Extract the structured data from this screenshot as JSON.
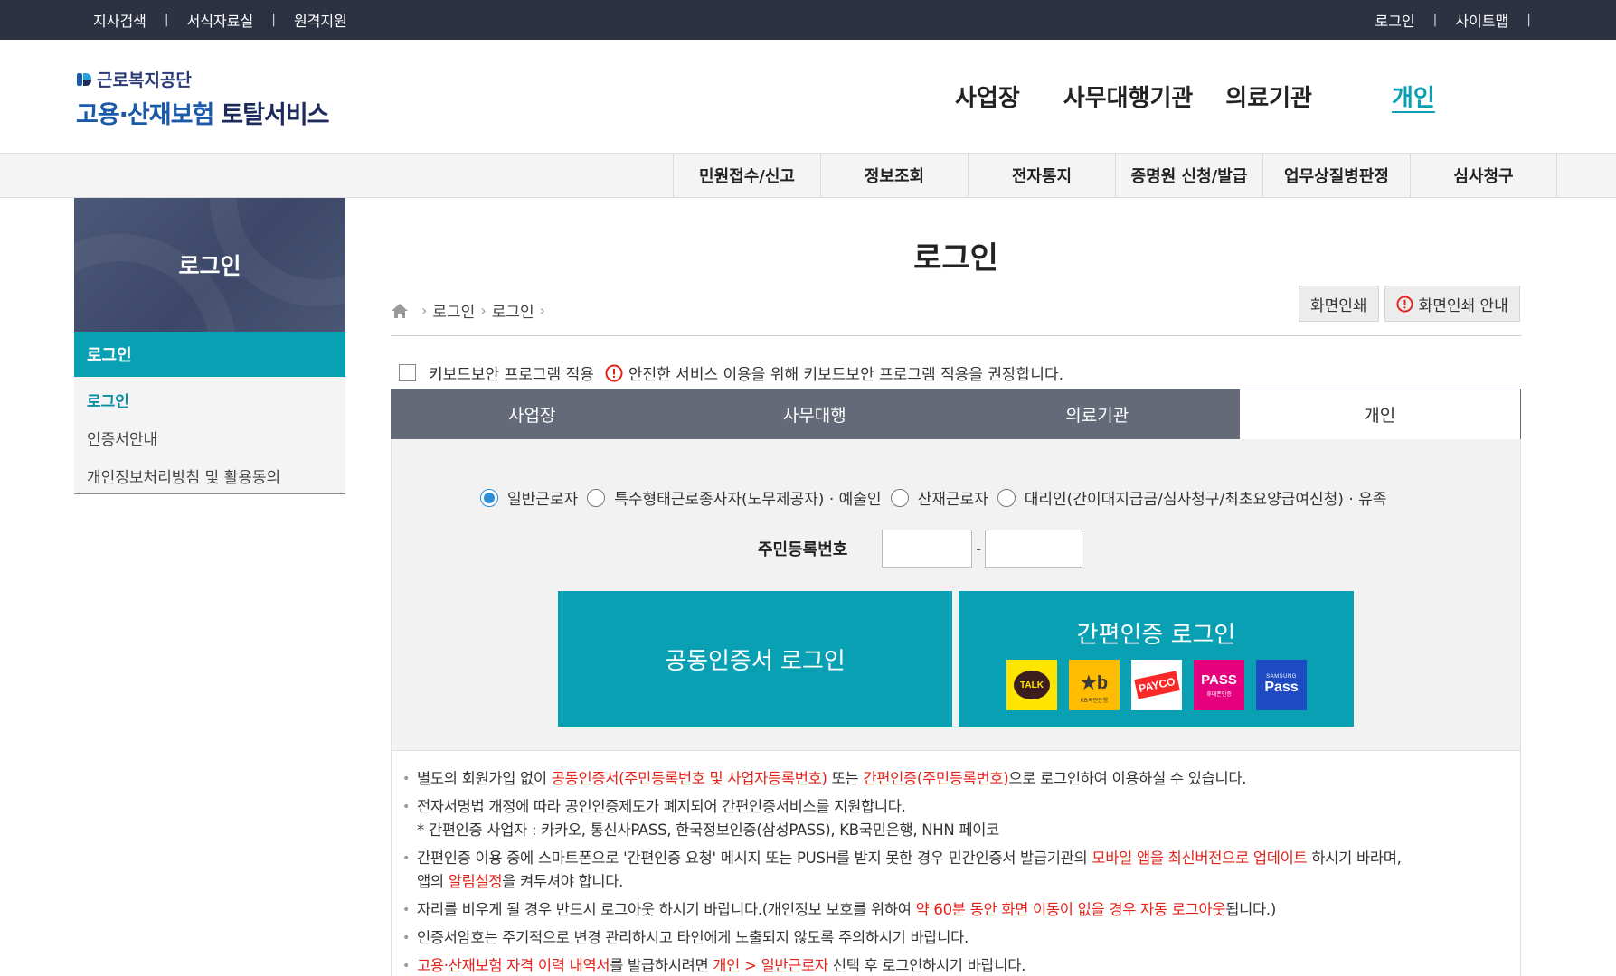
{
  "topbar": {
    "left": [
      "지사검색",
      "서식자료실",
      "원격지원"
    ],
    "right": [
      "로그인",
      "사이트맵"
    ],
    "sep": "|"
  },
  "logo": {
    "org": "근로복지공단",
    "svc_a": "고용·산재보험",
    "svc_b": "토탈서비스"
  },
  "mainnav": [
    "사업장",
    "사무대행기관",
    "의료기관",
    "개인"
  ],
  "subnav": [
    "민원접수/신고",
    "정보조회",
    "전자통지",
    "증명원 신청/발급",
    "업무상질병판정",
    "심사청구"
  ],
  "sidebar": {
    "title": "로그인",
    "active": "로그인",
    "items": [
      "로그인",
      "인증서안내",
      "개인정보처리방침 및 활용동의"
    ]
  },
  "page": {
    "title": "로그인",
    "breadcrumb": [
      "로그인",
      "로그인"
    ],
    "print": "화면인쇄",
    "print_guide": "화면인쇄 안내"
  },
  "keyboard": {
    "label": "키보드보안 프로그램 적용",
    "notice": "안전한 서비스 이용을 위해 키보드보안 프로그램 적용을 권장합니다."
  },
  "tabs": [
    "사업장",
    "사무대행",
    "의료기관",
    "개인"
  ],
  "radios": [
    "일반근로자",
    "특수형태근로종사자(노무제공자) · 예술인",
    "산재근로자",
    "대리인(간이대지급금/심사청구/최초요양급여신청) · 유족"
  ],
  "rrn": {
    "label": "주민등록번호",
    "dash": "-"
  },
  "buttons": {
    "cert": "공동인증서 로그인",
    "simple": "간편인증 로그인",
    "logos": {
      "kakao": "TALK",
      "kb_bank": "KB국민은행",
      "payco": "PAYCO",
      "pass": "PASS",
      "pass_sub": "휴대폰인증",
      "samsung": "SAMSUNG",
      "samsung_pass": "Pass"
    }
  },
  "notice": {
    "l1_a": "별도의 회원가입 없이 ",
    "l1_b": "공동인증서(주민등록번호 및 사업자등록번호)",
    "l1_c": " 또는 ",
    "l1_d": "간편인증(주민등록번호)",
    "l1_e": "으로 로그인하여 이용하실 수 있습니다.",
    "l2_a": "전자서명법 개정에 따라 공인인증제도가 폐지되어 간편인증서비스를 지원합니다.",
    "l2_b": "* 간편인증 사업자 : 카카오, 통신사PASS, 한국정보인증(삼성PASS), KB국민은행, NHN 페이코",
    "l3_a": "간편인증 이용 중에 스마트폰으로 '간편인증 요청' 메시지 또는 PUSH를 받지 못한 경우 민간인증서 발급기관의 ",
    "l3_b": "모바일 앱을 최신버전으로 업데이트",
    "l3_c": " 하시기 바라며,",
    "l3_d": "앱의 ",
    "l3_e": "알림설정",
    "l3_f": "을 켜두셔야 합니다.",
    "l4_a": "자리를 비우게 될 경우 반드시 로그아웃 하시기 바랍니다.(개인정보 보호를 위하여 ",
    "l4_b": "약 60분 동안 화면 이동이 없을 경우 자동 로그아웃",
    "l4_c": "됩니다.)",
    "l5": "인증서암호는 주기적으로 변경 관리하시고 타인에게 노출되지 않도록 주의하시기 바랍니다.",
    "l6_a": "고용·산재보험 자격 이력 내역서",
    "l6_b": "를 발급하시려면 ",
    "l6_c": "개인 > 일반근로자",
    "l6_d": " 선택 후 로그인하시기 바랍니다."
  },
  "colors": {
    "teal": "#0aa0b4",
    "topbar": "#2c3242",
    "tabbar": "#646a77",
    "red": "#e2231a"
  }
}
